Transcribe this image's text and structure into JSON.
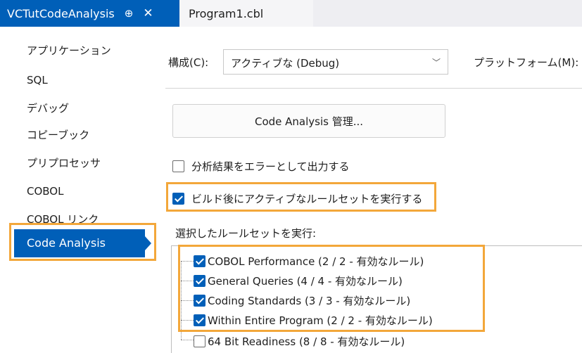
{
  "tabs": {
    "active": {
      "title": "VCTutCodeAnalysis",
      "pin": "⊕",
      "close": "✕"
    },
    "inactive": {
      "title": "Program1.cbl"
    }
  },
  "sidebar": {
    "items": [
      {
        "label": "アプリケーション"
      },
      {
        "label": "SQL"
      },
      {
        "label": "デバッグ"
      },
      {
        "label": "コピーブック"
      },
      {
        "label": "プリプロセッサ"
      },
      {
        "label": "COBOL"
      },
      {
        "label": "COBOL リンク"
      },
      {
        "label": "Code Analysis"
      }
    ],
    "selected": "Code Analysis"
  },
  "config": {
    "label": "構成(C):",
    "value": "アクティブな (Debug)",
    "platform_label": "プラットフォーム(M):"
  },
  "manage_button": {
    "label": "Code Analysis 管理..."
  },
  "checks": {
    "errors_output": {
      "label": "分析結果をエラーとして出力する",
      "checked": false
    },
    "run_after_build": {
      "label": "ビルド後にアクティブなルールセットを実行する",
      "checked": true
    }
  },
  "rulesets": {
    "label": "選択したルールセットを実行:",
    "items": [
      {
        "label": "COBOL Performance (2 / 2 - 有効なルール)",
        "checked": true
      },
      {
        "label": "General Queries (4 / 4 - 有効なルール)",
        "checked": true
      },
      {
        "label": "Coding Standards (3 / 3 - 有効なルール)",
        "checked": true
      },
      {
        "label": "Within Entire Program (2 / 2 - 有効なルール)",
        "checked": true
      },
      {
        "label": "64 Bit Readiness (8 / 8 - 有効なルール)",
        "checked": false
      }
    ]
  },
  "colors": {
    "accent": "#005fb8",
    "highlight": "#f3a73a"
  }
}
